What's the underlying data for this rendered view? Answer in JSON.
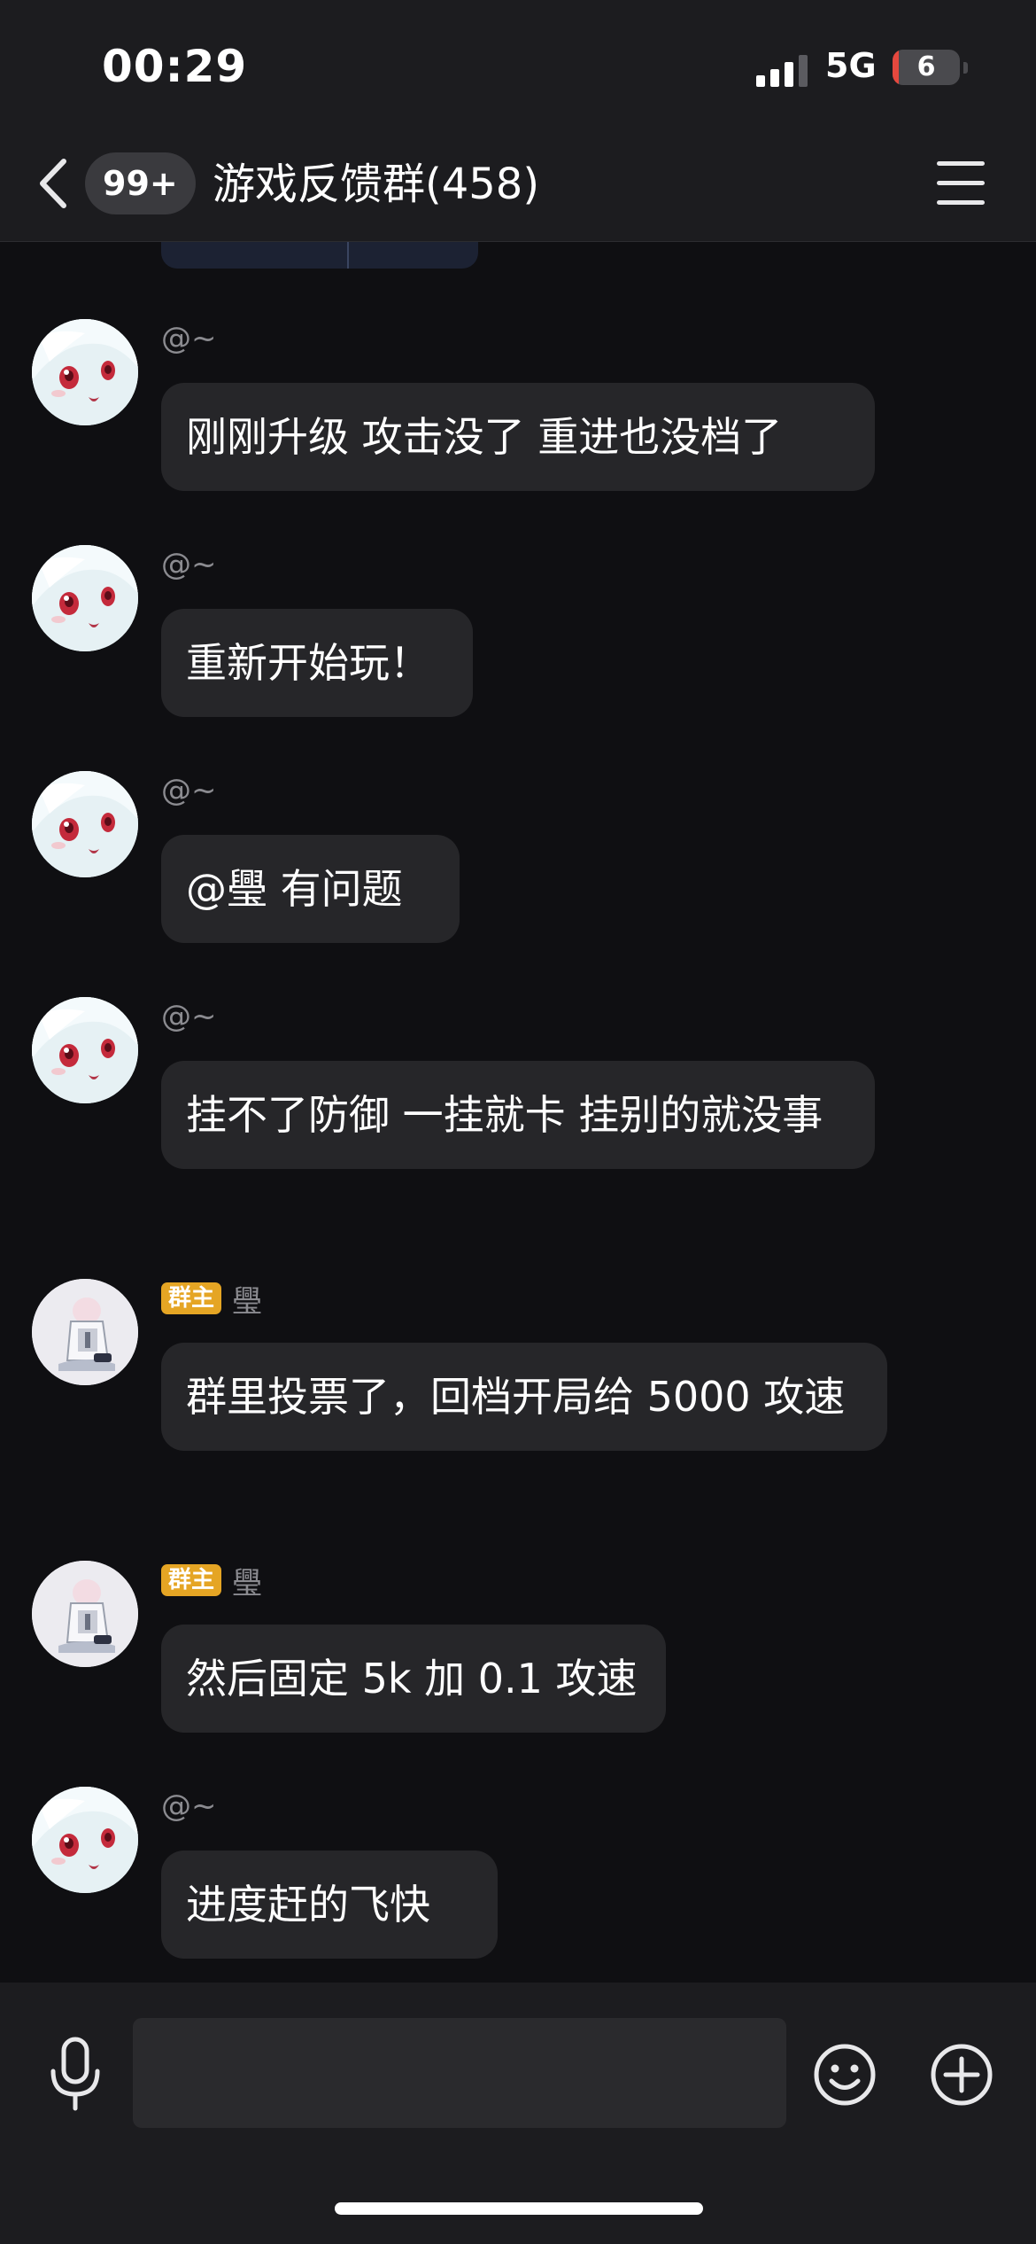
{
  "status_bar": {
    "time": "00:29",
    "network": "5G",
    "battery_level": "6",
    "signal_bars_active": 3,
    "signal_bars_total": 4
  },
  "header": {
    "unread_badge": "99+",
    "title": "游戏反馈群(458)",
    "back_icon": "chevron-left-icon",
    "menu_icon": "hamburger-menu-icon"
  },
  "messages": [
    {
      "sender": "@~",
      "owner_badge": "",
      "avatar": "anime-girl-avatar",
      "text": "刚刚升级 攻击没了 重进也没档了"
    },
    {
      "sender": "@~",
      "owner_badge": "",
      "avatar": "anime-girl-avatar",
      "text": "重新开始玩！"
    },
    {
      "sender": "@~",
      "owner_badge": "",
      "avatar": "anime-girl-avatar",
      "text": "@璺  有问题"
    },
    {
      "sender": "@~",
      "owner_badge": "",
      "avatar": "anime-girl-avatar",
      "text": "挂不了防御 一挂就卡 挂别的就没事"
    },
    {
      "sender": "璺",
      "owner_badge": "群主",
      "avatar": "sitting-character-avatar",
      "text": "群里投票了，回档开局给 5000 攻速"
    },
    {
      "sender": "璺",
      "owner_badge": "群主",
      "avatar": "sitting-character-avatar",
      "text": "然后固定 5k 加 0.1 攻速"
    },
    {
      "sender": "@~",
      "owner_badge": "",
      "avatar": "anime-girl-avatar",
      "text": "进度赶的飞快"
    }
  ],
  "input_bar": {
    "placeholder": "",
    "mic_icon": "microphone-icon",
    "emoji_icon": "emoji-icon",
    "plus_icon": "plus-circle-icon"
  },
  "colors": {
    "background": "#0f0f12",
    "bar": "#1c1c1f",
    "bubble": "#262629",
    "owner_badge": "#e5a524",
    "sender_name": "#8b8b90"
  }
}
